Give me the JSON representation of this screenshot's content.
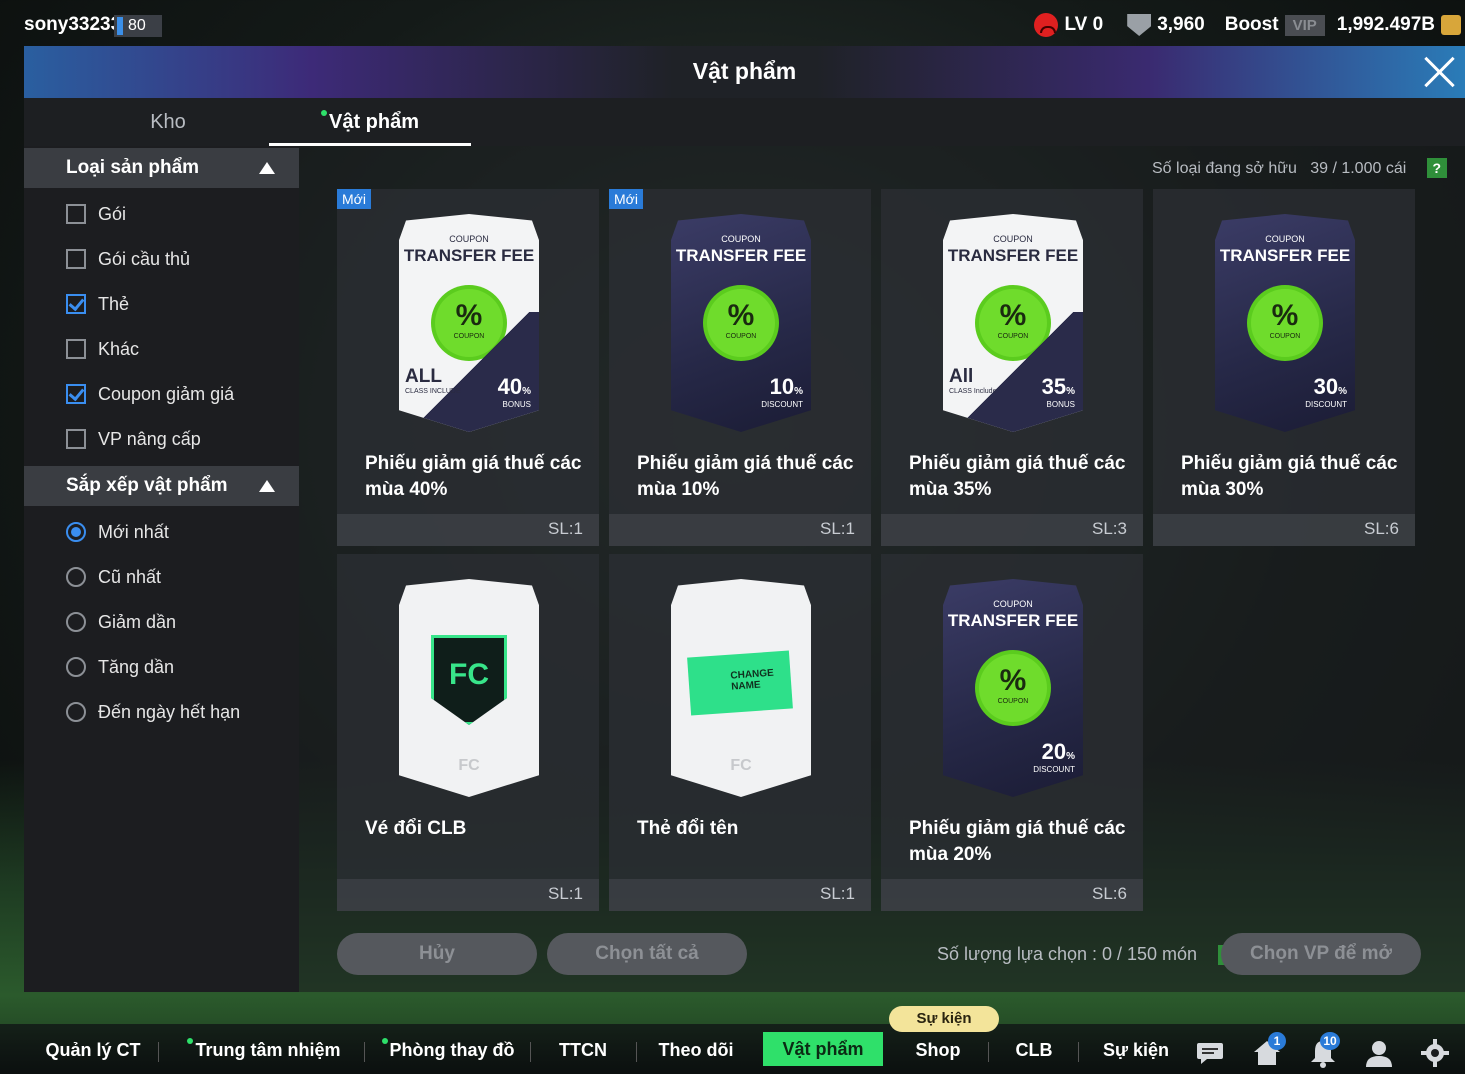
{
  "topbar": {
    "username": "sony33233",
    "level": "80",
    "rank": "LV 0",
    "shield_value": "3,960",
    "boost_label": "Boost",
    "vip_label": "VIP",
    "coins": "1,992.497B"
  },
  "header": {
    "title": "Vật phẩm"
  },
  "tabs": [
    {
      "label": "Kho"
    },
    {
      "label": "Vật phẩm"
    }
  ],
  "sidebar": {
    "category_title": "Loại sản phẩm",
    "categories": [
      {
        "label": "Gói",
        "checked": false
      },
      {
        "label": "Gói cầu thủ",
        "checked": false
      },
      {
        "label": "Thẻ",
        "checked": true
      },
      {
        "label": "Khác",
        "checked": false
      },
      {
        "label": "Coupon giảm giá",
        "checked": true
      },
      {
        "label": "VP nâng cấp",
        "checked": false
      }
    ],
    "sort_title": "Sắp xếp vật phẩm",
    "sorts": [
      {
        "label": "Mới nhất",
        "selected": true
      },
      {
        "label": "Cũ nhất",
        "selected": false
      },
      {
        "label": "Giảm dần",
        "selected": false
      },
      {
        "label": "Tăng dần",
        "selected": false
      },
      {
        "label": "Đến ngày hết hạn",
        "selected": false
      }
    ]
  },
  "content": {
    "owned_label": "Số loại đang sở hữu",
    "owned_value": "39 / 1.000 cái",
    "help": "?",
    "new_badge": "Mới",
    "coupon_small": "COUPON",
    "coupon_big": "TRANSFER FEE",
    "seal_symbol": "%",
    "seal_text": "COUPON",
    "items": [
      {
        "name": "Phiếu giảm giá thuế các mùa 40%",
        "qty": "SL:1",
        "new": true,
        "style": "white",
        "pct": "40",
        "unit": "%",
        "sub": "BONUS",
        "all": "ALL",
        "all_sub": "CLASS INCLUDE"
      },
      {
        "name": "Phiếu giảm giá thuế các mùa 10%",
        "qty": "SL:1",
        "new": true,
        "style": "dark",
        "pct": "10",
        "unit": "%",
        "sub": "DISCOUNT"
      },
      {
        "name": "Phiếu giảm giá thuế các mùa 35%",
        "qty": "SL:3",
        "new": false,
        "style": "white",
        "pct": "35",
        "unit": "%",
        "sub": "BONUS",
        "all": "All",
        "all_sub": "CLASS Include"
      },
      {
        "name": "Phiếu giảm giá thuế các mùa 30%",
        "qty": "SL:6",
        "new": false,
        "style": "dark",
        "pct": "30",
        "unit": "%",
        "sub": "DISCOUNT"
      },
      {
        "name": "Vé đổi CLB",
        "qty": "SL:1",
        "new": false,
        "style": "clb"
      },
      {
        "name": "Thẻ đổi tên",
        "qty": "SL:1",
        "new": false,
        "style": "rename",
        "ticket_text": "CHANGE NAME"
      },
      {
        "name": "Phiếu giảm giá thuế các mùa 20%",
        "qty": "SL:6",
        "new": false,
        "style": "dark",
        "pct": "20",
        "unit": "%",
        "sub": "DISCOUNT"
      }
    ]
  },
  "actions": {
    "cancel": "Hủy",
    "select_all": "Chọn tất cả",
    "selection_count": "Số lượng lựa chọn : 0 / 150 món",
    "open": "Chọn VP để mở"
  },
  "nav": {
    "items": [
      {
        "label": "Quản lý CT"
      },
      {
        "label": "Trung tâm nhiệm vụ"
      },
      {
        "label": "Phòng thay đồ"
      },
      {
        "label": "TTCN"
      },
      {
        "label": "Theo dõi"
      },
      {
        "label": "Vật phẩm"
      },
      {
        "label": "Shop"
      },
      {
        "label": "CLB"
      },
      {
        "label": "Sự kiện"
      }
    ],
    "event_pill": "Sự kiện",
    "home_badge": "1",
    "bell_badge": "10"
  },
  "colors": {
    "accent_green": "#2fe06a",
    "accent_blue": "#3a8ef0",
    "seal_green": "#6fdc2c"
  }
}
